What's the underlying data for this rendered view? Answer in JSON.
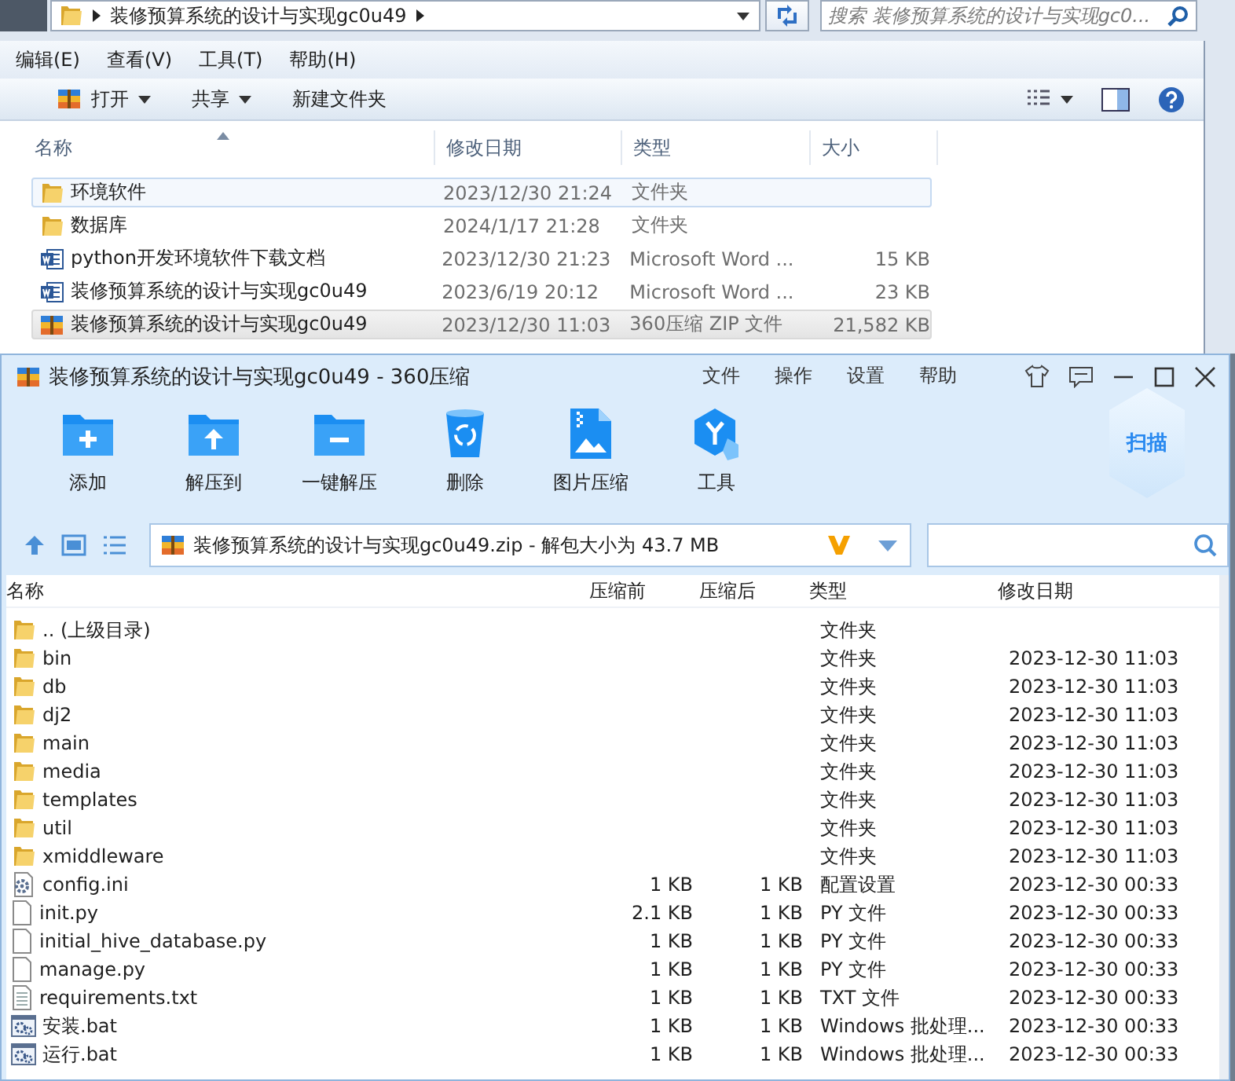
{
  "explorer": {
    "breadcrumb": "装修预算系统的设计与实现gc0u49",
    "search_placeholder": "搜索 装修预算系统的设计与实现gc0...",
    "menu": [
      "编辑(E)",
      "查看(V)",
      "工具(T)",
      "帮助(H)"
    ],
    "toolbar": [
      {
        "label": "打开",
        "kind": "open",
        "dropdown": true
      },
      {
        "label": "共享",
        "kind": "plain",
        "dropdown": true
      },
      {
        "label": "新建文件夹",
        "kind": "plain",
        "dropdown": false
      }
    ],
    "columns": [
      {
        "label": "名称",
        "sorted": true
      },
      {
        "label": "修改日期",
        "sorted": false
      },
      {
        "label": "类型",
        "sorted": false
      },
      {
        "label": "大小",
        "sorted": false
      }
    ],
    "files": [
      {
        "name": "环境软件",
        "kind": "folder",
        "date": "2023/12/30 21:24",
        "type": "文件夹",
        "focused": true,
        "selected": false
      },
      {
        "name": "数据库",
        "kind": "folder",
        "date": "2024/1/17 21:28",
        "type": "文件夹",
        "focused": false,
        "selected": false
      },
      {
        "name": "python开发环境软件下载文档",
        "kind": "word",
        "date": "2023/12/30 21:23",
        "type": "Microsoft Word ...",
        "size": "15 KB",
        "focused": false,
        "selected": false
      },
      {
        "name": "装修预算系统的设计与实现gc0u49",
        "kind": "word",
        "date": "2023/6/19 20:12",
        "type": "Microsoft Word ...",
        "size": "23 KB",
        "focused": false,
        "selected": false
      },
      {
        "name": "装修预算系统的设计与实现gc0u49",
        "kind": "zip",
        "date": "2023/12/30 11:03",
        "type": "360压缩 ZIP 文件",
        "size": "21,582 KB",
        "focused": false,
        "selected": true
      }
    ]
  },
  "archive": {
    "title": "装修预算系统的设计与实现gc0u49 - 360压缩",
    "menu": [
      "文件",
      "操作",
      "设置",
      "帮助"
    ],
    "tools": [
      {
        "label": "添加",
        "kind": "add"
      },
      {
        "label": "解压到",
        "kind": "extract"
      },
      {
        "label": "一键解压",
        "kind": "quick"
      },
      {
        "label": "删除",
        "kind": "delete"
      },
      {
        "label": "图片压缩",
        "kind": "image"
      },
      {
        "label": "工具",
        "kind": "tools"
      }
    ],
    "scan_badge": "扫描",
    "path": "装修预算系统的设计与实现gc0u49.zip - 解包大小为 43.7 MB",
    "columns": [
      "名称",
      "压缩前",
      "压缩后",
      "类型",
      "修改日期"
    ],
    "rows": [
      {
        "name": ".. (上级目录)",
        "kind": "folder",
        "type": "文件夹"
      },
      {
        "name": "bin",
        "kind": "folder",
        "type": "文件夹",
        "date": "2023-12-30 11:03"
      },
      {
        "name": "db",
        "kind": "folder",
        "type": "文件夹",
        "date": "2023-12-30 11:03"
      },
      {
        "name": "dj2",
        "kind": "folder",
        "type": "文件夹",
        "date": "2023-12-30 11:03"
      },
      {
        "name": "main",
        "kind": "folder",
        "type": "文件夹",
        "date": "2023-12-30 11:03"
      },
      {
        "name": "media",
        "kind": "folder",
        "type": "文件夹",
        "date": "2023-12-30 11:03"
      },
      {
        "name": "templates",
        "kind": "folder",
        "type": "文件夹",
        "date": "2023-12-30 11:03"
      },
      {
        "name": "util",
        "kind": "folder",
        "type": "文件夹",
        "date": "2023-12-30 11:03"
      },
      {
        "name": "xmiddleware",
        "kind": "folder",
        "type": "文件夹",
        "date": "2023-12-30 11:03"
      },
      {
        "name": "config.ini",
        "kind": "config",
        "before": "1 KB",
        "after": "1 KB",
        "type": "配置设置",
        "date": "2023-12-30 00:33"
      },
      {
        "name": "init.py",
        "kind": "file",
        "before": "2.1 KB",
        "after": "1 KB",
        "type": "PY 文件",
        "date": "2023-12-30 00:33"
      },
      {
        "name": "initial_hive_database.py",
        "kind": "file",
        "before": "1 KB",
        "after": "1 KB",
        "type": "PY 文件",
        "date": "2023-12-30 00:33"
      },
      {
        "name": "manage.py",
        "kind": "file",
        "before": "1 KB",
        "after": "1 KB",
        "type": "PY 文件",
        "date": "2023-12-30 00:33"
      },
      {
        "name": "requirements.txt",
        "kind": "text",
        "before": "1 KB",
        "after": "1 KB",
        "type": "TXT 文件",
        "date": "2023-12-30 00:33"
      },
      {
        "name": "安装.bat",
        "kind": "batch",
        "before": "1 KB",
        "after": "1 KB",
        "type": "Windows 批处理...",
        "date": "2023-12-30 00:33"
      },
      {
        "name": "运行.bat",
        "kind": "batch",
        "before": "1 KB",
        "after": "1 KB",
        "type": "Windows 批处理...",
        "date": "2023-12-30 00:33"
      }
    ]
  }
}
